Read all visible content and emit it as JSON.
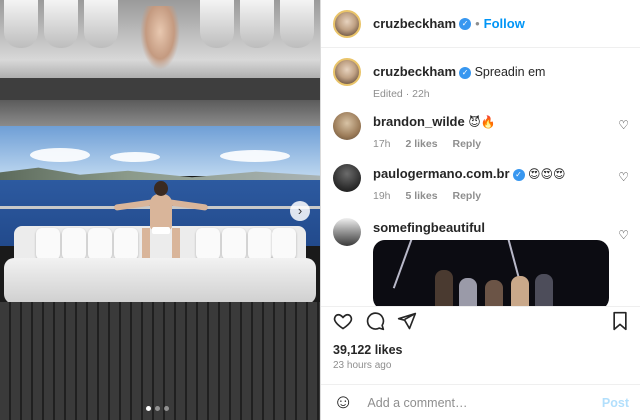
{
  "header": {
    "username": "cruzbeckham",
    "separator": "•",
    "follow_label": "Follow"
  },
  "caption": {
    "username": "cruzbeckham",
    "text": "Spreadin em",
    "edited": "Edited · 22h"
  },
  "comments": [
    {
      "username": "brandon_wilde",
      "emoji": "😈🔥",
      "time": "17h",
      "likes": "2 likes",
      "reply": "Reply"
    },
    {
      "username": "paulogermano.com.br",
      "emoji": "😍😍😍",
      "time": "19h",
      "likes": "5 likes",
      "reply": "Reply"
    },
    {
      "username": "somefingbeautiful"
    }
  ],
  "post": {
    "likes": "39,122 likes",
    "time_ago": "23 hours ago"
  },
  "composer": {
    "placeholder": "Add a comment…",
    "post_label": "Post"
  },
  "carousel": {
    "slides": 3,
    "active_slide": 1
  },
  "icons": {
    "verified": "✓",
    "next": "›",
    "heart": "♡",
    "smile": "☺"
  },
  "colors": {
    "accent": "#0095f6",
    "verified": "#3897f0"
  }
}
